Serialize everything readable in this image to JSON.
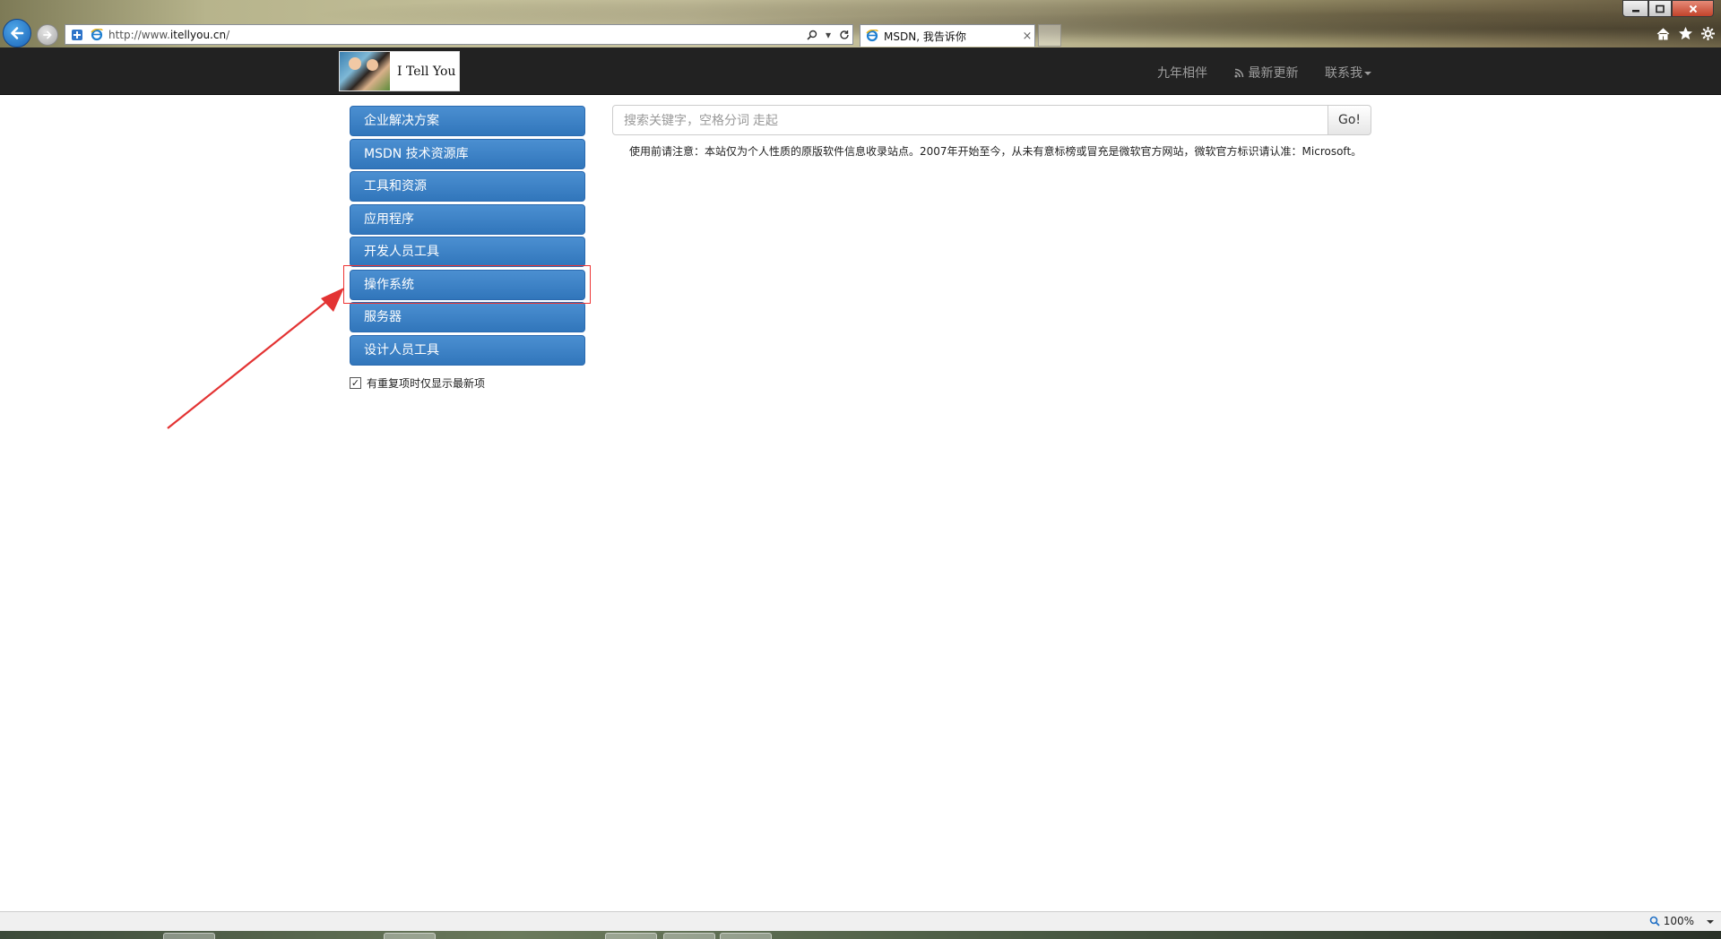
{
  "browser": {
    "url_prefix": "http://www.",
    "url_domain": "itellyou.cn",
    "url_suffix": "/",
    "tab_title": "MSDN, 我告诉你",
    "tab_close": "×",
    "zoom_level": "100%"
  },
  "navbar": {
    "brand_text": "I Tell You",
    "links": [
      "九年相伴",
      "最新更新",
      "联系我"
    ]
  },
  "sidebar": {
    "items": [
      {
        "label": "企业解决方案"
      },
      {
        "label": "MSDN 技术资源库"
      },
      {
        "label": "工具和资源"
      },
      {
        "label": "应用程序"
      },
      {
        "label": "开发人员工具"
      },
      {
        "label": "操作系统"
      },
      {
        "label": "服务器"
      },
      {
        "label": "设计人员工具"
      }
    ],
    "checkbox_label": "有重复项时仅显示最新项",
    "checkbox_checked": true
  },
  "search": {
    "placeholder": "搜索关键字，空格分词 走起",
    "go_label": "Go!"
  },
  "notice": "使用前请注意：本站仅为个人性质的原版软件信息收录站点。2007年开始至今，从未有意标榜或冒充是微软官方网站，微软官方标识请认准：Microsoft。",
  "annotation": {
    "color": "#e33333"
  }
}
